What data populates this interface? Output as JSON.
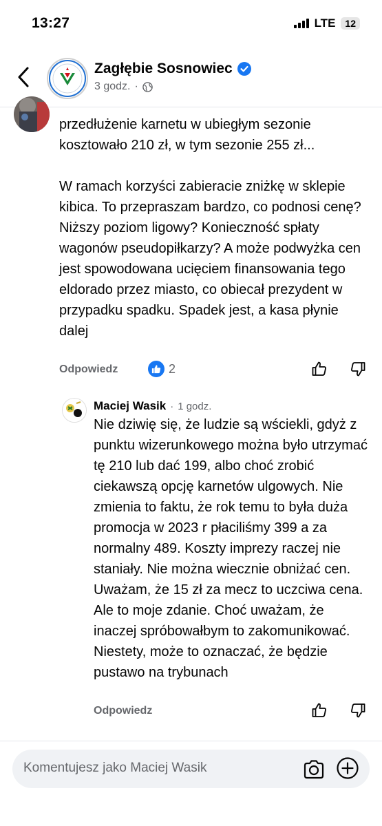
{
  "status_bar": {
    "time": "13:27",
    "network": "LTE",
    "battery": "12"
  },
  "header": {
    "page_name": "Zagłębie Sosnowiec",
    "time_ago": "3 godz.",
    "separator": "·"
  },
  "comment_main": {
    "text": "przedłużenie karnetu w ubiegłym sezonie kosztowało 210 zł, w tym sezonie 255 zł...\n\nW ramach korzyści zabieracie zniżkę w sklepie kibica. To przepraszam bardzo, co podnosi cenę? Niższy poziom ligowy? Konieczność spłaty wagonów pseudopiłkarzy? A może podwyżka cen jest spowodowana ucięciem finansowania tego eldorado przez miasto, co obiecał prezydent w przypadku spadku. Spadek jest, a kasa płynie dalej",
    "reply_label": "Odpowiedz",
    "like_count": "2"
  },
  "reply": {
    "author": "Maciej Wasik",
    "separator": "·",
    "time_ago": "1 godz.",
    "text": "Nie dziwię się, że ludzie są wściekli, gdyż z punktu wizerunkowego można było utrzymać tę 210 lub dać 199, albo choć zrobić ciekawszą opcję karnetów ulgowych. Nie zmienia to faktu, że rok temu to była duża promocja w 2023 r płaciliśmy 399 a za normalny 489. Koszty imprezy raczej nie staniały. Nie można wiecznie obniżać cen. Uważam, że 15 zł za mecz to uczciwa cena. Ale to moje zdanie. Choć uważam, że inaczej spróbowałbym to zakomunikować. Niestety, może to oznaczać, że będzie pustawo na trybunach",
    "reply_label": "Odpowiedz"
  },
  "composer": {
    "placeholder": "Komentujesz jako Maciej Wasik"
  },
  "colors": {
    "accent": "#1877f2",
    "secondary_text": "#65676b",
    "composer_bg": "#f0f2f5"
  }
}
